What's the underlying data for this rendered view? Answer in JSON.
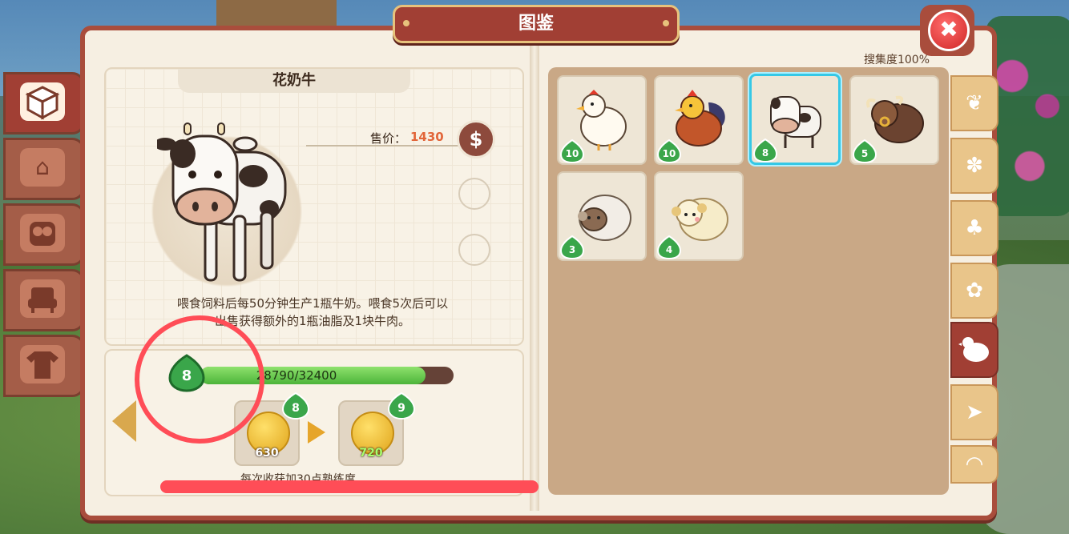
{
  "window": {
    "title": "图鉴",
    "close_icon": "close-icon",
    "collection_text": "搜集度100%"
  },
  "left_tabs": [
    {
      "icon": "crate-icon",
      "active": true
    },
    {
      "icon": "house-icon",
      "active": false
    },
    {
      "icon": "owl-icon",
      "active": false
    },
    {
      "icon": "armchair-icon",
      "active": false
    },
    {
      "icon": "shirt-icon",
      "active": false
    }
  ],
  "detail": {
    "name": "花奶牛",
    "price_label": "售价：",
    "price_value": "1430",
    "price_icon": "dollar-coin-icon",
    "description_line1": "喂食饲料后每50分钟生产1瓶牛奶。喂食5次后可以",
    "description_line2": "出售获得额外的1瓶油脂及1块牛肉。",
    "level": "8",
    "xp_text": "28790/32400",
    "xp_progress": 0.8886,
    "reward_current": {
      "level": "8",
      "amount": "630"
    },
    "reward_next": {
      "level": "9",
      "amount": "720"
    },
    "footnote": "每次收获加30点熟练度"
  },
  "animals": [
    {
      "name": "chicken",
      "level": "10",
      "selected": false
    },
    {
      "name": "rooster",
      "level": "10",
      "selected": false
    },
    {
      "name": "cow",
      "level": "8",
      "selected": true
    },
    {
      "name": "yak",
      "level": "5",
      "selected": false
    },
    {
      "name": "sheep",
      "level": "3",
      "selected": false
    },
    {
      "name": "alpaca-sheep",
      "level": "4",
      "selected": false
    }
  ],
  "right_tabs": [
    {
      "icon": "wheat-icon",
      "active": false
    },
    {
      "icon": "grain-icon",
      "active": false
    },
    {
      "icon": "tree-icon",
      "active": false
    },
    {
      "icon": "flower-icon",
      "active": false
    },
    {
      "icon": "hen-icon",
      "active": true
    },
    {
      "icon": "fish-icon",
      "active": false
    },
    {
      "icon": "shell-icon",
      "active": false
    }
  ],
  "colors": {
    "accent": "#a13f34",
    "progress": "#4cb43a",
    "annotation": "#ff4d57",
    "selected_border": "#35c8e6"
  }
}
